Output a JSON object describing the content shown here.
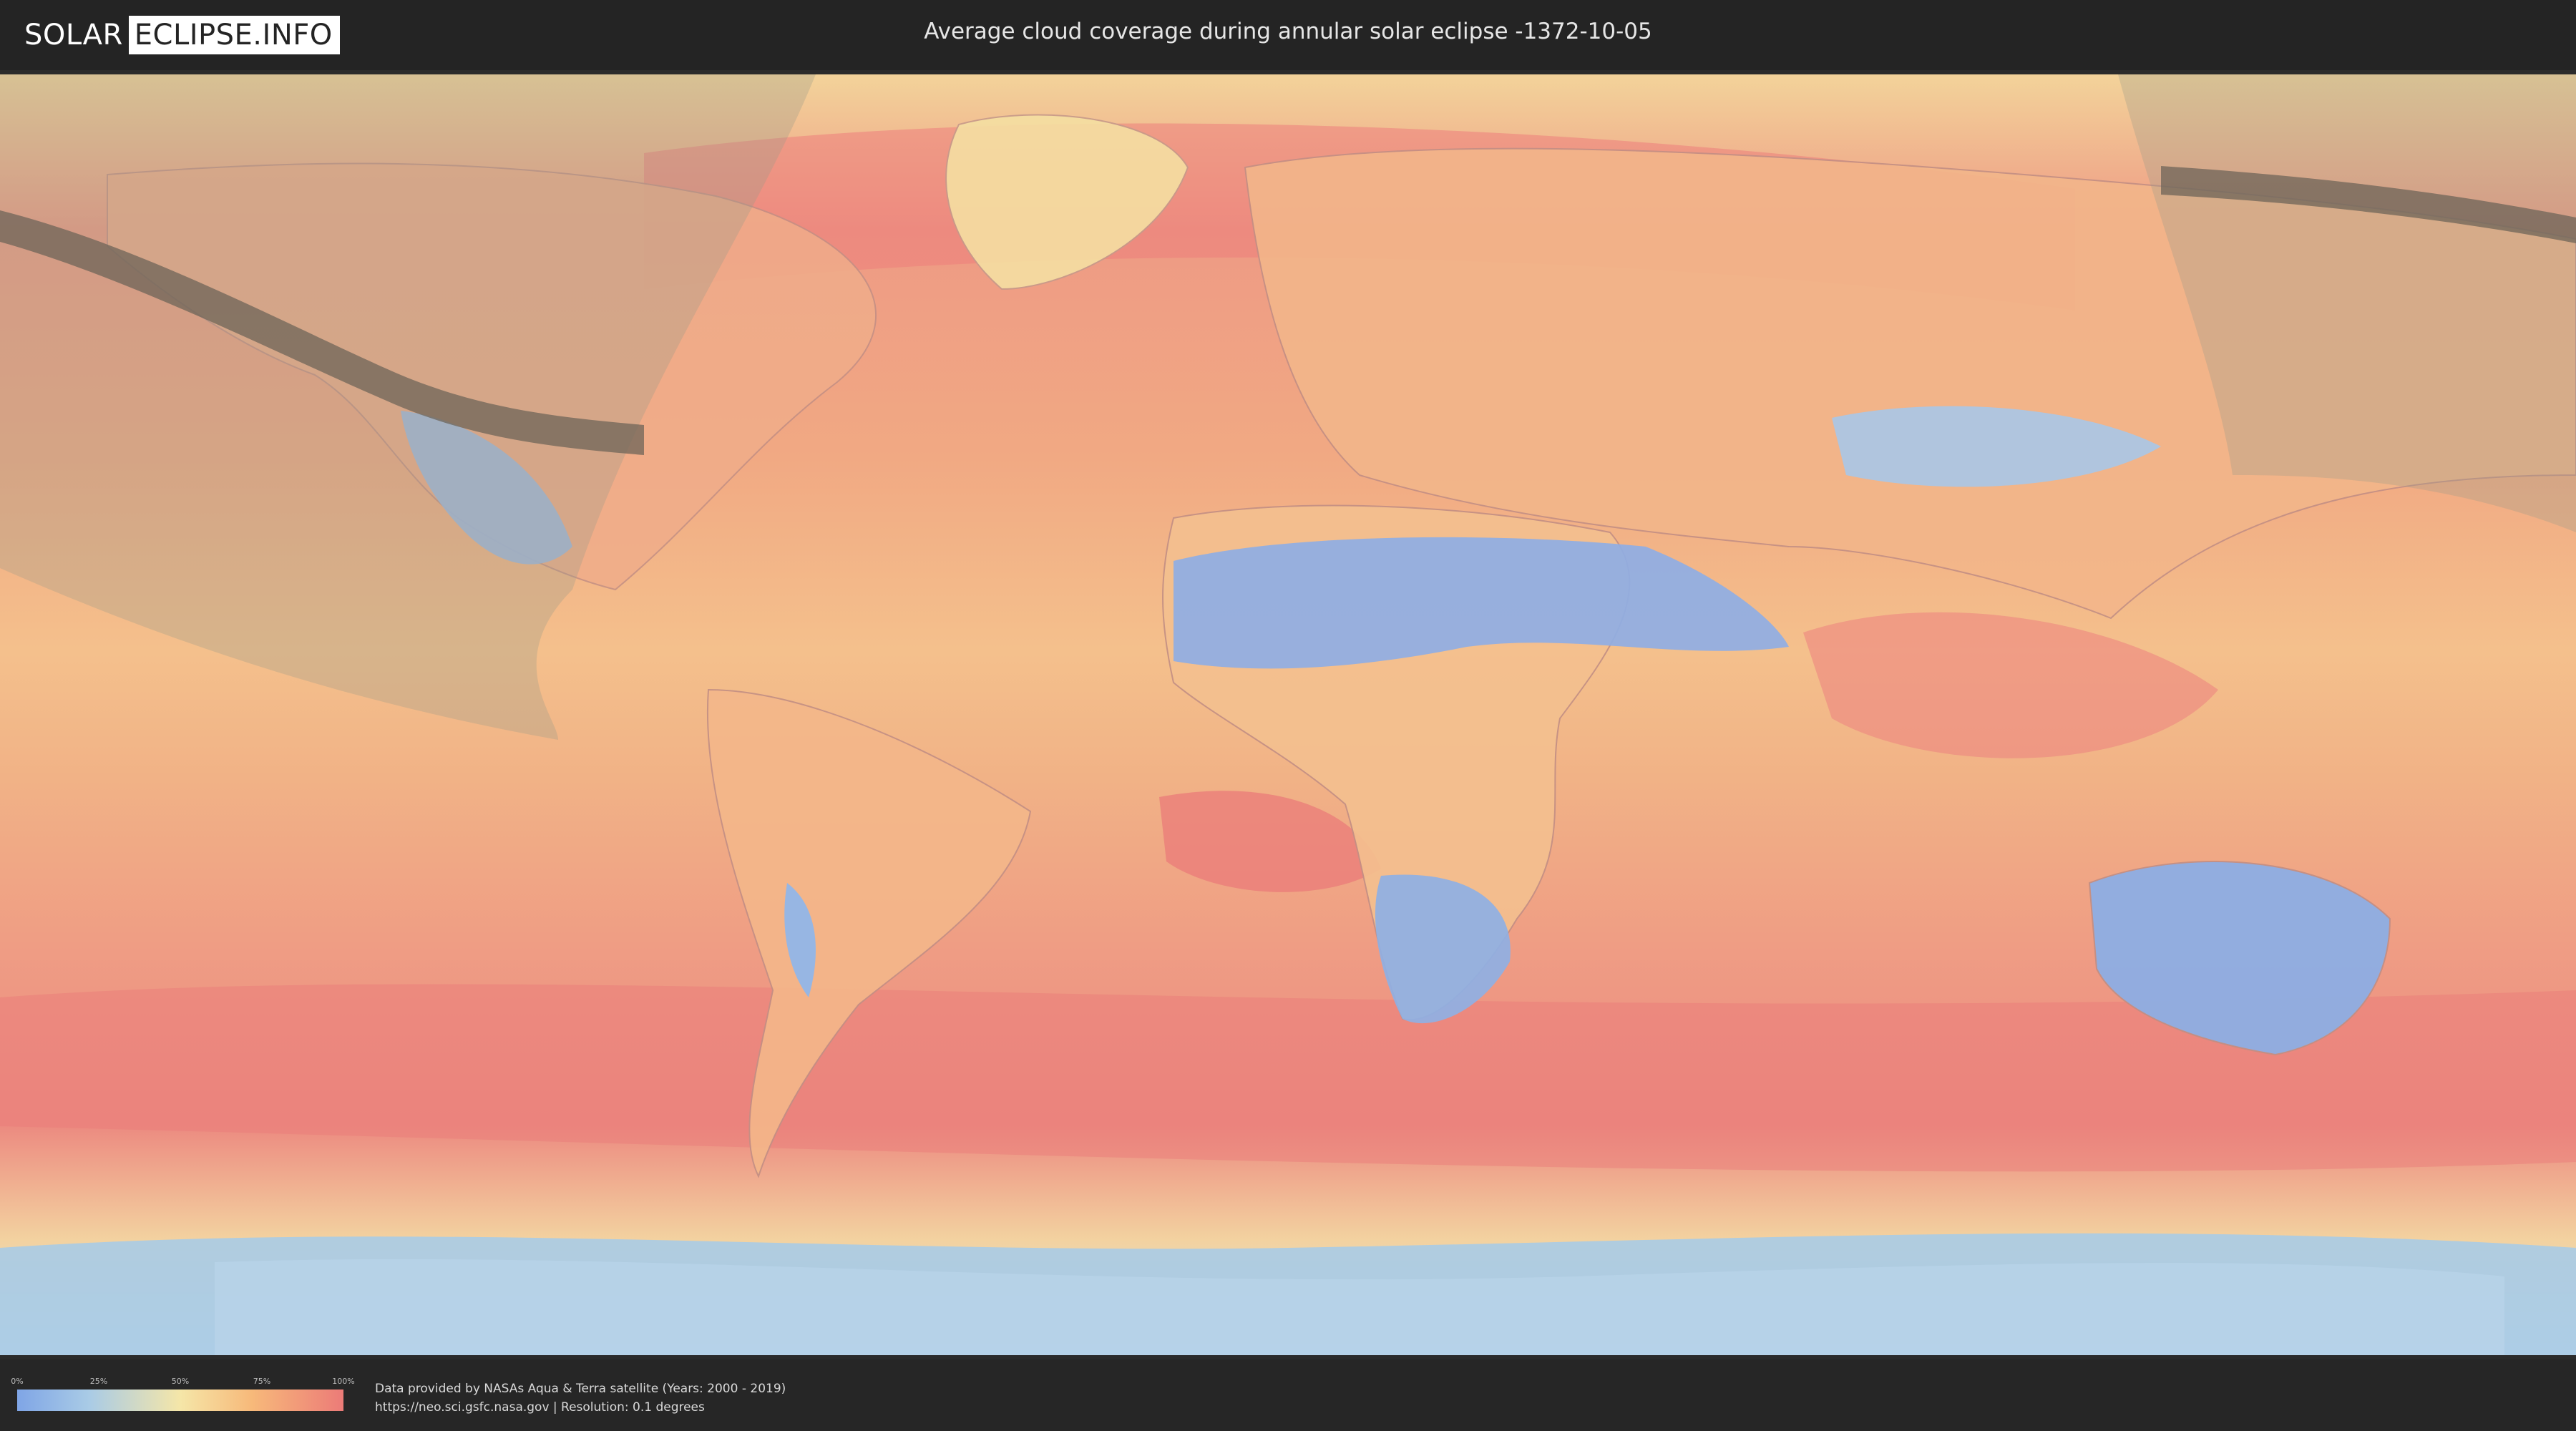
{
  "header": {
    "logo_solar": "SOLAR",
    "logo_eclipse": "ECLIPSE.INFO",
    "title": "Average cloud coverage during annular solar eclipse -1372-10-05"
  },
  "map": {
    "type": "cloud-coverage-world-map",
    "colors": {
      "clear": "#7fa5e6",
      "low": "#a9cbe6",
      "mid": "#f5e6a8",
      "high": "#f7b97a",
      "overcast": "#ec7b78",
      "eclipse_path": "#6e6458",
      "visibility_overlay": "#9a9a8a"
    }
  },
  "legend": {
    "ticks": [
      "0%",
      "25%",
      "50%",
      "75%",
      "100%"
    ]
  },
  "credits": {
    "line1": "Data provided by NASAs Aqua & Terra satellite (Years: 2000 - 2019)",
    "line2": "https://neo.sci.gsfc.nasa.gov | Resolution: 0.1 degrees"
  }
}
